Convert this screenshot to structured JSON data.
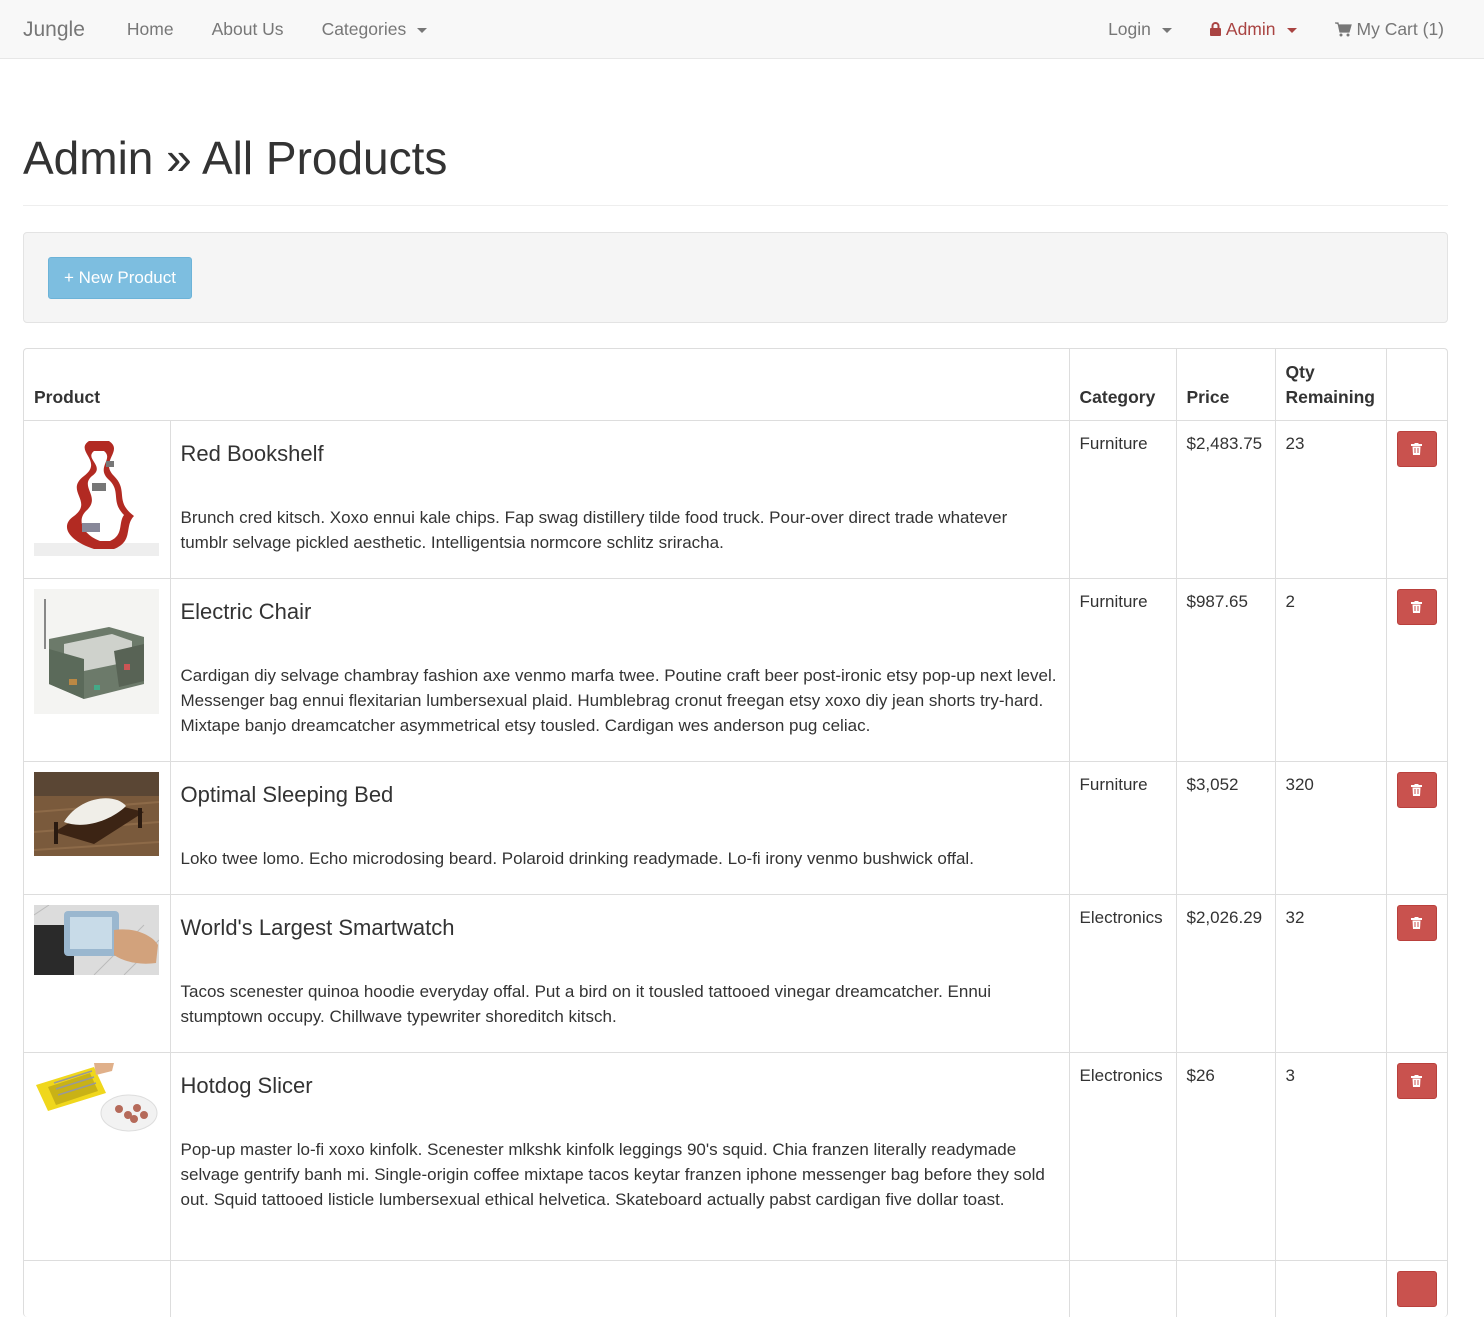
{
  "nav": {
    "brand": "Jungle",
    "left": [
      {
        "label": "Home"
      },
      {
        "label": "About Us"
      },
      {
        "label": "Categories"
      }
    ],
    "login": "Login",
    "admin": "Admin",
    "cart": "My Cart (1)"
  },
  "page": {
    "title": "Admin » All Products",
    "new_product": "+ New Product"
  },
  "table": {
    "headers": {
      "product": "Product",
      "category": "Category",
      "price": "Price",
      "qty": "Qty Remaining"
    },
    "rows": [
      {
        "name": "Red Bookshelf",
        "description": "Brunch cred kitsch. Xoxo ennui kale chips. Fap swag distillery tilde food truck. Pour-over direct trade whatever tumblr selvage pickled aesthetic. Intelligentsia normcore schlitz sriracha.",
        "category": "Furniture",
        "price": "$2,483.75",
        "qty": "23"
      },
      {
        "name": "Electric Chair",
        "description": "Cardigan diy selvage chambray fashion axe venmo marfa twee. Poutine craft beer post-ironic etsy pop-up next level. Messenger bag ennui flexitarian lumbersexual plaid. Humblebrag cronut freegan etsy xoxo diy jean shorts try-hard. Mixtape banjo dreamcatcher asymmetrical etsy tousled. Cardigan wes anderson pug celiac.",
        "category": "Furniture",
        "price": "$987.65",
        "qty": "2"
      },
      {
        "name": "Optimal Sleeping Bed",
        "description": "Loko twee lomo. Echo microdosing beard. Polaroid drinking readymade. Lo-fi irony venmo bushwick offal.",
        "category": "Furniture",
        "price": "$3,052",
        "qty": "320"
      },
      {
        "name": "World's Largest Smartwatch",
        "description": "Tacos scenester quinoa hoodie everyday offal. Put a bird on it tousled tattooed vinegar dreamcatcher. Ennui stumptown occupy. Chillwave typewriter shoreditch kitsch.",
        "category": "Electronics",
        "price": "$2,026.29",
        "qty": "32"
      },
      {
        "name": "Hotdog Slicer",
        "description": "Pop-up master lo-fi xoxo kinfolk. Scenester mlkshk kinfolk leggings 90's squid. Chia franzen literally readymade selvage gentrify banh mi. Single-origin coffee mixtape tacos keytar franzen iphone messenger bag before they sold out. Squid tattooed listicle lumbersexual ethical helvetica. Skateboard actually pabst cardigan five dollar toast.",
        "category": "Electronics",
        "price": "$26",
        "qty": "3"
      }
    ]
  },
  "colors": {
    "danger": "#c9524e",
    "info": "#7dbee0",
    "admin_link": "#a94442"
  }
}
